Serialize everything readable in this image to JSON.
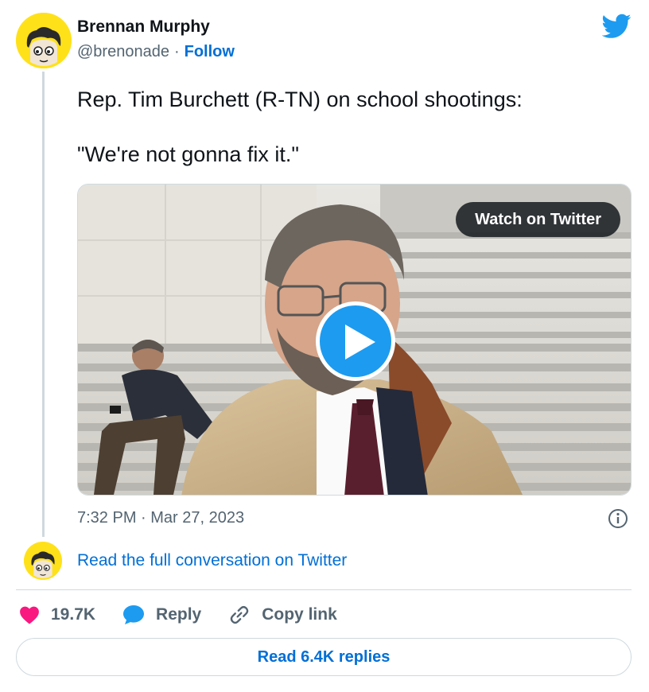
{
  "author": {
    "name": "Brennan Murphy",
    "handle": "@brenonade",
    "separator": "·",
    "follow_label": "Follow",
    "avatar_icon": "cartoon-face-avatar"
  },
  "brand": {
    "icon": "twitter-bird-icon",
    "color": "#1d9bf0"
  },
  "tweet": {
    "line1": "Rep. Tim Burchett (R-TN) on school shootings:",
    "line2": "\"We're not gonna fix it.\""
  },
  "media": {
    "watch_label": "Watch on Twitter",
    "play_icon": "play-icon"
  },
  "meta": {
    "timestamp": "7:32 PM · Mar 27, 2023",
    "info_icon": "info-icon"
  },
  "conversation_link": "Read the full conversation on Twitter",
  "actions": {
    "like_count": "19.7K",
    "like_icon": "heart-icon",
    "like_color": "#f91880",
    "reply_label": "Reply",
    "reply_icon": "speech-bubble-icon",
    "copy_label": "Copy link",
    "copy_icon": "link-icon"
  },
  "replies_button": "Read 6.4K replies",
  "colors": {
    "link": "#006fd6",
    "muted": "#536471",
    "border": "#cfd9de"
  }
}
